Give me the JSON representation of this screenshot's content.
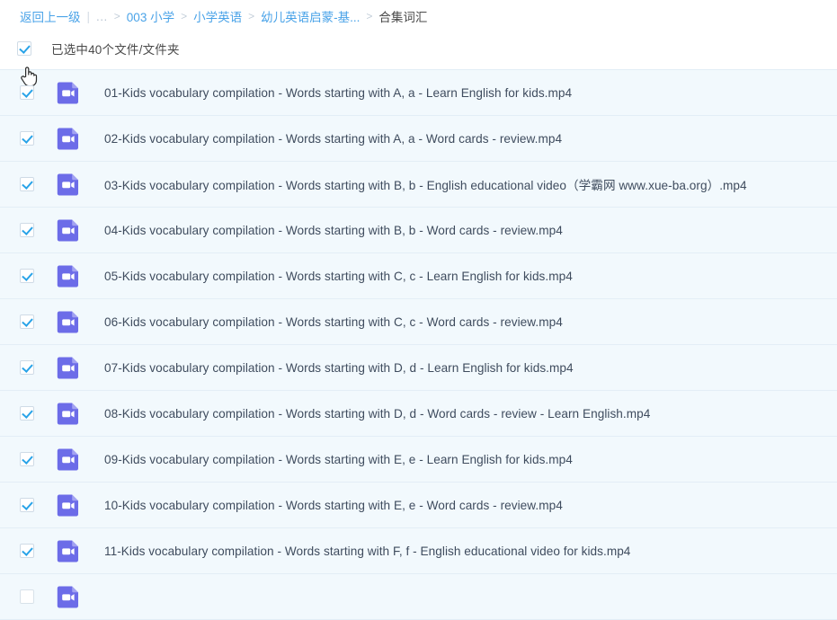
{
  "breadcrumb": {
    "back_label": "返回上一级",
    "ellipsis": "...",
    "separator": ">",
    "items": [
      {
        "label": "003 小学",
        "current": false
      },
      {
        "label": "小学英语",
        "current": false
      },
      {
        "label": "幼儿英语启蒙-基...",
        "current": false
      },
      {
        "label": "合集词汇",
        "current": true
      }
    ]
  },
  "select_bar": {
    "label": "已选中40个文件/文件夹",
    "checked": true,
    "cursor_icon": "hand-pointer-cursor"
  },
  "colors": {
    "link": "#4aa3e8",
    "row_background": "#f2f9fd",
    "row_divider": "#e3eef6",
    "checkbox_check": "#29a3e8",
    "video_icon": "#6c6ce8",
    "text": "#3f4c5e"
  },
  "files": [
    {
      "checked": true,
      "icon": "video-file-icon",
      "name": "01-Kids vocabulary compilation - Words starting with A, a - Learn English for kids.mp4"
    },
    {
      "checked": true,
      "icon": "video-file-icon",
      "name": "02-Kids vocabulary compilation - Words starting with A, a - Word cards - review.mp4"
    },
    {
      "checked": true,
      "icon": "video-file-icon",
      "name": "03-Kids vocabulary compilation - Words starting with B, b - English educational video（学霸网 www.xue-ba.org）.mp4"
    },
    {
      "checked": true,
      "icon": "video-file-icon",
      "name": "04-Kids vocabulary compilation - Words starting with B, b - Word cards - review.mp4"
    },
    {
      "checked": true,
      "icon": "video-file-icon",
      "name": "05-Kids vocabulary compilation - Words starting with C, c - Learn English for kids.mp4"
    },
    {
      "checked": true,
      "icon": "video-file-icon",
      "name": "06-Kids vocabulary compilation - Words starting with C, c - Word cards - review.mp4"
    },
    {
      "checked": true,
      "icon": "video-file-icon",
      "name": "07-Kids vocabulary compilation - Words starting with D, d - Learn English for kids.mp4"
    },
    {
      "checked": true,
      "icon": "video-file-icon",
      "name": "08-Kids vocabulary compilation - Words starting with D, d - Word cards - review - Learn English.mp4"
    },
    {
      "checked": true,
      "icon": "video-file-icon",
      "name": "09-Kids vocabulary compilation - Words starting with E, e - Learn English for kids.mp4"
    },
    {
      "checked": true,
      "icon": "video-file-icon",
      "name": "10-Kids vocabulary compilation - Words starting with E, e - Word cards - review.mp4"
    },
    {
      "checked": true,
      "icon": "video-file-icon",
      "name": "11-Kids vocabulary compilation - Words starting with F, f - English educational video for kids.mp4"
    },
    {
      "checked": false,
      "icon": "video-file-icon",
      "name": ""
    }
  ]
}
